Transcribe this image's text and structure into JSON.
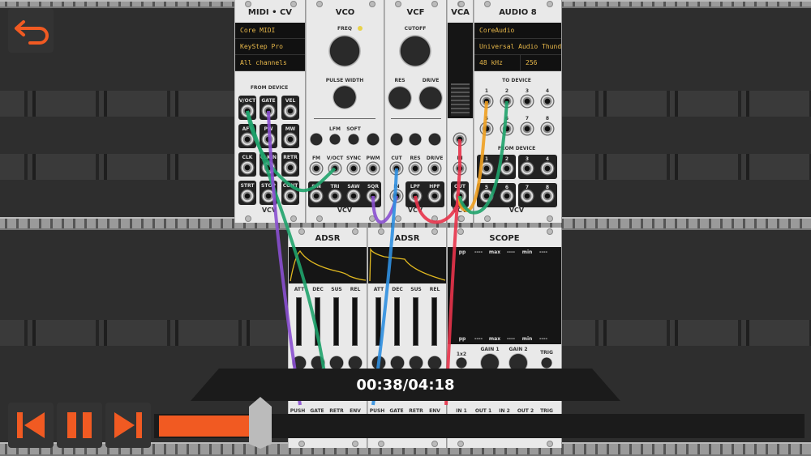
{
  "midi_cv": {
    "title": "MIDI • CV",
    "displays": [
      "Core MIDI",
      "KeyStep Pro",
      "All channels"
    ],
    "section": "FROM DEVICE",
    "jacks": [
      "V/OCT",
      "GATE",
      "VEL",
      "AFT",
      "PW",
      "MW",
      "CLK",
      "CLK/N",
      "RETR",
      "STRT",
      "STOP",
      "CONT"
    ]
  },
  "vco": {
    "title": "VCO",
    "freq": "FREQ",
    "pulse_width": "PULSE WIDTH",
    "mod_labels": [
      "LFM",
      "SOFT"
    ],
    "inputs": [
      "FM",
      "V/OCT",
      "SYNC",
      "PWM"
    ],
    "outputs": [
      "SIN",
      "TRI",
      "SAW",
      "SQR"
    ]
  },
  "vcf": {
    "title": "VCF",
    "cutoff": "CUTOFF",
    "res": "RES",
    "drive": "DRIVE",
    "inputs": [
      "CUT",
      "RES",
      "DRIVE"
    ],
    "in": "IN",
    "outputs": [
      "LPF",
      "HPF"
    ]
  },
  "vca": {
    "title": "VCA",
    "in": "IN",
    "out": "OUT"
  },
  "audio8": {
    "title": "AUDIO 8",
    "displays": [
      "CoreAudio",
      "Universal Audio Thunderbolt",
      "48 kHz",
      "256"
    ],
    "to_device": "TO DEVICE",
    "from_device": "FROM DEVICE",
    "numbers": [
      "1",
      "2",
      "3",
      "4",
      "5",
      "6",
      "7",
      "8"
    ]
  },
  "brand": "VCV",
  "adsr": [
    {
      "title": "ADSR",
      "params": [
        "ATT",
        "DEC",
        "SUS",
        "REL"
      ],
      "ports": [
        "PUSH",
        "GATE",
        "RETR",
        "ENV"
      ]
    },
    {
      "title": "ADSR",
      "params": [
        "ATT",
        "DEC",
        "SUS",
        "REL"
      ],
      "ports": [
        "PUSH",
        "GATE",
        "RETR",
        "ENV"
      ]
    }
  ],
  "scope": {
    "title": "SCOPE",
    "stats": [
      "pp",
      "----",
      "max",
      "----",
      "min",
      "----"
    ],
    "knobs": [
      "1x2",
      "GAIN 1",
      "GAIN 2",
      "TRIG"
    ],
    "ports": [
      "IN 1",
      "OUT 1",
      "IN 2",
      "OUT 2",
      "TRIG"
    ]
  },
  "player": {
    "time": "00:38/04:18",
    "progress_percent": 14.5,
    "accent": "#f15a22"
  },
  "cables": {
    "green": "#1fa36b",
    "purple": "#8a4fd0",
    "blue": "#2f8fe0",
    "red": "#e8334a",
    "orange": "#f0a020"
  }
}
